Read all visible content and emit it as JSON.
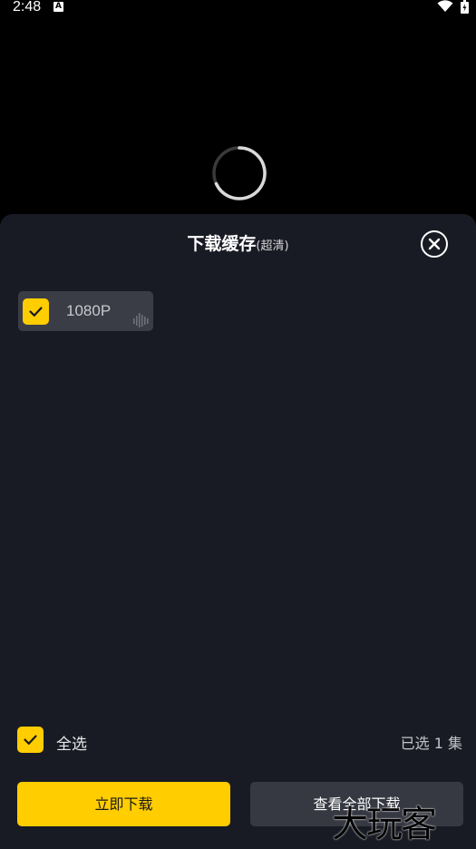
{
  "status_bar": {
    "time": "2:48",
    "notification_icon": "A"
  },
  "sheet": {
    "title": "下载缓存",
    "subtitle": "(超清)"
  },
  "quality_option": {
    "label": "1080P",
    "checked": true
  },
  "footer": {
    "select_all_label": "全选",
    "selected_count": "已选 1 集",
    "download_now_label": "立即下载",
    "view_all_label": "查看全部下载"
  },
  "watermark": {
    "text": "大玩客"
  },
  "colors": {
    "accent": "#ffcd00",
    "sheet_background": "#191b24",
    "chip_background": "#3a3c46",
    "secondary_button": "#363842"
  }
}
